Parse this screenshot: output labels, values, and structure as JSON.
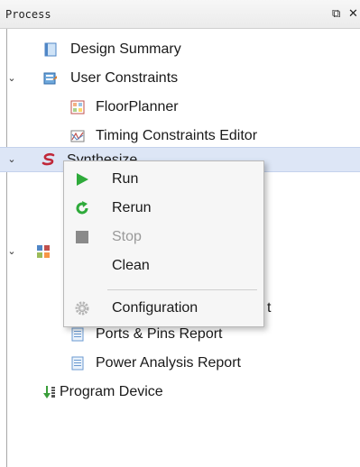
{
  "panel": {
    "title": "Process",
    "float_icon": "⧉",
    "close_icon": "✕"
  },
  "tree": {
    "design_summary": "Design Summary",
    "user_constraints": "User Constraints",
    "floorplanner": "FloorPlanner",
    "timing_constraints_editor": "Timing Constraints Editor",
    "synthesize": "Synthesize",
    "place_route_report_partial": "t",
    "ports_pins_report": "Ports & Pins Report",
    "power_analysis_report": "Power Analysis Report",
    "program_device": "Program Device"
  },
  "context_menu": {
    "run": "Run",
    "rerun": "Rerun",
    "stop": "Stop",
    "clean": "Clean",
    "configuration": "Configuration"
  },
  "colors": {
    "selection": "#dde6f6",
    "run_green": "#2eaa3a",
    "stop_gray": "#8a8a8a"
  }
}
